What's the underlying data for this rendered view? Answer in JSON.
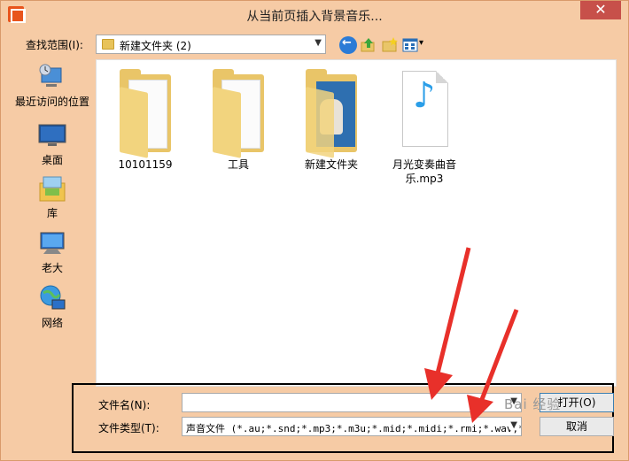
{
  "window": {
    "title": "从当前页插入背景音乐...",
    "close_glyph": "✕"
  },
  "toolbar": {
    "lookin_label": "查找范围(I):",
    "lookin_value": "新建文件夹 (2)",
    "view_arrow": "▾"
  },
  "sidebar": {
    "items": [
      {
        "label": "最近访问的位置",
        "icon": "recent-places-icon"
      },
      {
        "label": "桌面",
        "icon": "desktop-icon"
      },
      {
        "label": "库",
        "icon": "libraries-icon"
      },
      {
        "label": "老大",
        "icon": "computer-icon"
      },
      {
        "label": "网络",
        "icon": "network-icon"
      }
    ]
  },
  "files": [
    {
      "name": "10101159",
      "type": "folder"
    },
    {
      "name": "工具",
      "type": "folder"
    },
    {
      "name": "新建文件夹",
      "type": "folder"
    },
    {
      "name": "月光变奏曲音乐.mp3",
      "type": "audio"
    }
  ],
  "bottom": {
    "filename_label": "文件名(N):",
    "filename_value": "",
    "filetype_label": "文件类型(T):",
    "filetype_value": "声音文件 (*.au;*.snd;*.mp3;*.m3u;*.mid;*.midi;*.rmi;*.wav;*.",
    "open_label": "打开(O)",
    "cancel_label": "取消"
  },
  "watermark": "Bai 经验",
  "colors": {
    "frame": "#f6cba5",
    "close": "#c7504a",
    "arrow": "#e8302a",
    "note": "#2a9ee8"
  }
}
